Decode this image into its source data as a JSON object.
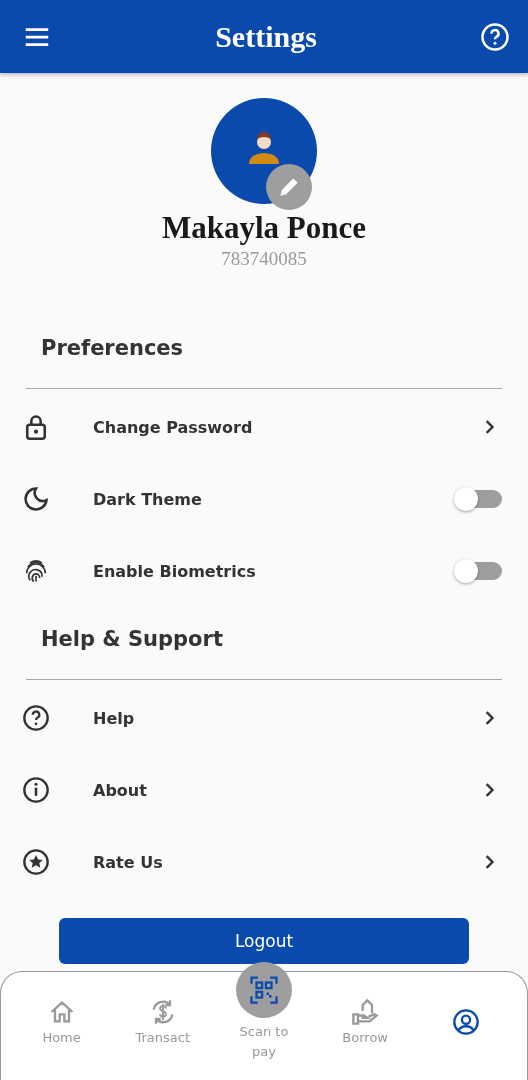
{
  "header": {
    "title": "Settings"
  },
  "profile": {
    "name": "Makayla Ponce",
    "account_number": "783740085"
  },
  "sections": [
    {
      "title": "Preferences",
      "items": [
        {
          "label": "Change Password",
          "kind": "link"
        },
        {
          "label": "Dark Theme",
          "kind": "toggle",
          "on": false
        },
        {
          "label": "Enable Biometrics",
          "kind": "toggle",
          "on": false
        }
      ]
    },
    {
      "title": "Help & Support",
      "items": [
        {
          "label": "Help",
          "kind": "link"
        },
        {
          "label": "About",
          "kind": "link"
        },
        {
          "label": "Rate Us",
          "kind": "link"
        }
      ]
    }
  ],
  "logout_button": "Logout",
  "bottom_nav": [
    {
      "label": "Home",
      "kind": "tab",
      "selected": false
    },
    {
      "label": "Transact",
      "kind": "tab",
      "selected": false
    },
    {
      "label": "Scan to pay",
      "kind": "scan",
      "selected": false
    },
    {
      "label": "Borrow",
      "kind": "tab",
      "selected": false
    },
    {
      "kind": "tab",
      "selected": true
    }
  ]
}
